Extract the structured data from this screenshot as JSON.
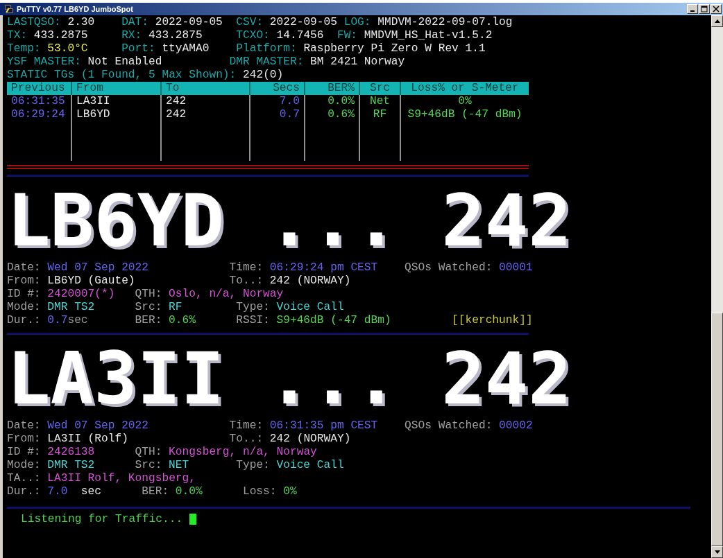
{
  "window": {
    "title": "PuTTY v0.77 LB6YD JumboSpot"
  },
  "status_lines": [
    [
      {
        "label": "LASTQSO:",
        "parts": [
          {
            "text": "2.30",
            "color": "#e8e8e8"
          }
        ]
      },
      {
        "label": "DAT:",
        "parts": [
          {
            "text": "2022-09-05",
            "color": "#e8e8e8"
          }
        ]
      },
      {
        "label": "CSV:",
        "parts": [
          {
            "text": "2022-09-05",
            "color": "#e8e8e8"
          }
        ]
      },
      {
        "label": "LOG:",
        "parts": [
          {
            "text": "MMDVM-2022-09-07.log",
            "color": "#e8e8e8"
          }
        ]
      }
    ],
    [
      {
        "label": "TX:",
        "parts": [
          {
            "text": "433.2875",
            "color": "#e8e8e8"
          }
        ]
      },
      {
        "label": "RX:",
        "parts": [
          {
            "text": "433.2875",
            "color": "#e8e8e8"
          }
        ]
      },
      {
        "label": "TCXO:",
        "parts": [
          {
            "text": "14.7456",
            "color": "#e8e8e8"
          }
        ]
      },
      {
        "label": "FW:",
        "parts": [
          {
            "text": "MMDVM_HS_Hat-v1.5.2",
            "color": "#e8e8e8"
          }
        ]
      }
    ],
    [
      {
        "label": "Temp:",
        "parts": [
          {
            "text": "53.0°C",
            "color": "#e8e84a"
          }
        ]
      },
      {
        "label": "Port:",
        "parts": [
          {
            "text": "ttyAMA0",
            "color": "#e8e8e8"
          }
        ]
      },
      {
        "label": "Platform:",
        "parts": [
          {
            "text": "Raspberry Pi Zero W Rev 1.1",
            "color": "#e8e8e8"
          }
        ]
      }
    ],
    [
      {
        "label": "YSF MASTER:",
        "parts": [
          {
            "text": "Not Enabled",
            "color": "#e8e8e8"
          }
        ]
      },
      {
        "label": "DMR MASTER:",
        "parts": [
          {
            "text": "BM 2421 Norway",
            "color": "#e8e8e8"
          }
        ]
      }
    ],
    [
      {
        "label": "STATIC TGs (1 Found, 5 Max Shown):",
        "parts": [
          {
            "text": "242(0)",
            "color": "#e8e8e8"
          }
        ]
      }
    ]
  ],
  "table": {
    "columns": [
      "Previous",
      "From",
      "To",
      "Secs",
      "BER%",
      "Src",
      "Loss% or S-Meter"
    ],
    "rows": [
      [
        "06:31:35",
        "LA3II",
        "242",
        "7.0",
        "0.0%",
        "Net",
        "0%"
      ],
      [
        "06:29:24",
        "LB6YD",
        "242",
        "0.7",
        "0.6%",
        "RF",
        "S9+46dB (-47 dBm)"
      ]
    ]
  },
  "qsos": [
    {
      "banner": "LB6YD ... 242",
      "lines": [
        [
          {
            "label": "Date:",
            "parts": [
              {
                "text": "Wed 07 Sep 2022",
                "color": "#6464f0"
              }
            ]
          },
          {
            "label": "Time:",
            "parts": [
              {
                "text": "06:29:24 pm CEST",
                "color": "#6464f0"
              }
            ]
          },
          {
            "label": "QSOs Watched:",
            "parts": [
              {
                "text": "00001",
                "color": "#6464f0"
              }
            ]
          }
        ],
        [
          {
            "label": "From:",
            "parts": [
              {
                "text": "LB6YD (Gaute)",
                "color": "#e8e8e8"
              }
            ]
          },
          {
            "label": "To..:",
            "parts": [
              {
                "text": "242 (NORWAY)",
                "color": "#e8e8e8"
              }
            ]
          }
        ],
        [
          {
            "label": "ID #:",
            "parts": [
              {
                "text": "2420007(*)",
                "color": "#d452d4"
              }
            ]
          },
          {
            "label": "QTH:",
            "parts": [
              {
                "text": "Oslo, n/a, Norway",
                "color": "#d452d4"
              }
            ]
          }
        ],
        [
          {
            "label": "Mode:",
            "parts": [
              {
                "text": "DMR TS2",
                "color": "#4ad4d4"
              }
            ]
          },
          {
            "label": "Src:",
            "parts": [
              {
                "text": "RF",
                "color": "#4ad4d4"
              }
            ]
          },
          {
            "label": "Type:",
            "parts": [
              {
                "text": "Voice Call",
                "color": "#4ad4d4"
              }
            ]
          }
        ],
        [
          {
            "label": "Dur.:",
            "parts": [
              {
                "text": "0.7",
                "color": "#6464f0"
              },
              {
                "text": "sec",
                "color": "#9a9a9a"
              }
            ]
          },
          {
            "label": "BER:",
            "parts": [
              {
                "text": "0.6%",
                "color": "#52d452"
              }
            ]
          },
          {
            "label": "RSSI:",
            "parts": [
              {
                "text": "S9+46dB (-47 dBm)",
                "color": "#52d452"
              }
            ]
          },
          {
            "parts": [
              {
                "text": "[[kerchunk]]",
                "color": "#c8c832"
              }
            ]
          }
        ]
      ]
    },
    {
      "banner": "LA3II ... 242",
      "lines": [
        [
          {
            "label": "Date:",
            "parts": [
              {
                "text": "Wed 07 Sep 2022",
                "color": "#6464f0"
              }
            ]
          },
          {
            "label": "Time:",
            "parts": [
              {
                "text": "06:31:35 pm CEST",
                "color": "#6464f0"
              }
            ]
          },
          {
            "label": "QSOs Watched:",
            "parts": [
              {
                "text": "00002",
                "color": "#6464f0"
              }
            ]
          }
        ],
        [
          {
            "label": "From:",
            "parts": [
              {
                "text": "LA3II (Rolf)",
                "color": "#e8e8e8"
              }
            ]
          },
          {
            "label": "To..:",
            "parts": [
              {
                "text": "242 (NORWAY)",
                "color": "#e8e8e8"
              }
            ]
          }
        ],
        [
          {
            "label": "ID #:",
            "parts": [
              {
                "text": "2426138",
                "color": "#d452d4"
              }
            ]
          },
          {
            "label": "QTH:",
            "parts": [
              {
                "text": "Kongsberg, n/a, Norway",
                "color": "#d452d4"
              }
            ]
          }
        ],
        [
          {
            "label": "Mode:",
            "parts": [
              {
                "text": "DMR TS2",
                "color": "#4ad4d4"
              }
            ]
          },
          {
            "label": "Src:",
            "parts": [
              {
                "text": "NET",
                "color": "#4ad4d4"
              }
            ]
          },
          {
            "label": "Type:",
            "parts": [
              {
                "text": "Voice Call",
                "color": "#4ad4d4"
              }
            ]
          }
        ],
        [
          {
            "label": "TA..:",
            "parts": [
              {
                "text": "LA3II Rolf, Kongsberg,",
                "color": "#d452d4"
              }
            ]
          }
        ],
        [
          {
            "label": "Dur.:",
            "parts": [
              {
                "text": "7.0",
                "color": "#6464f0"
              }
            ]
          },
          {
            "parts": [
              {
                "text": "sec",
                "color": "#e8e8e8"
              }
            ]
          },
          {
            "label": "BER:",
            "parts": [
              {
                "text": "0.0%",
                "color": "#52d452"
              }
            ]
          },
          {
            "label": "Loss:",
            "parts": [
              {
                "text": "0%",
                "color": "#52d452"
              }
            ]
          }
        ]
      ]
    }
  ],
  "prompt": "Listening for Traffic..."
}
